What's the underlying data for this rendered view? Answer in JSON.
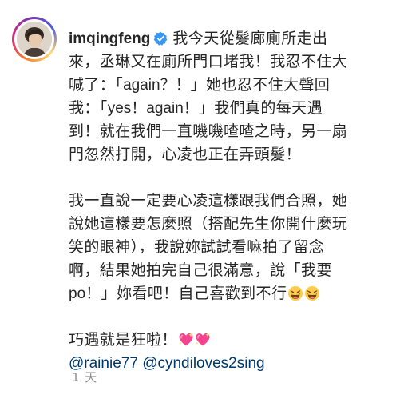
{
  "post": {
    "username": "imqingfeng",
    "verified": true,
    "caption": {
      "lines": [
        "我今天從髮廊廁所走出",
        "來，丞琳又在廁所門口堵我！我忍不住大",
        "喊了：「",
        "again？！",
        "」她也忍不住大聲回",
        "我：「",
        "yes！again！",
        "」我們真的每天遇",
        "到！就在我們一直嘰嘰喳喳之時，另一扇",
        "門忽然打開，心凌也正在弄頭髮！",
        "我一直說一定要心凌這樣跟我們合照，她",
        "說她這樣要怎麼照（搭配先生你開什麼玩",
        "笑的眼神），我說妳試試看嘛拍了留念",
        "啊，結果她拍完自己很滿意，說「我要",
        "po",
        "！」妳看吧！自己喜歡到不行",
        "巧遇就是狂啦！"
      ],
      "emoji_after_line_16": [
        "laughing-emoji",
        "laughing-emoji"
      ],
      "emoji_after_line_17": [
        "sparkling-heart-emoji",
        "sparkling-heart-emoji"
      ],
      "mentions": [
        "@rainie77",
        "@cyndiloves2sing"
      ]
    },
    "timestamp": "1 天"
  },
  "colors": {
    "text": "#262626",
    "mention": "#00376b",
    "timestamp": "#8e8e8e",
    "verified_badge": "#3897f0"
  }
}
